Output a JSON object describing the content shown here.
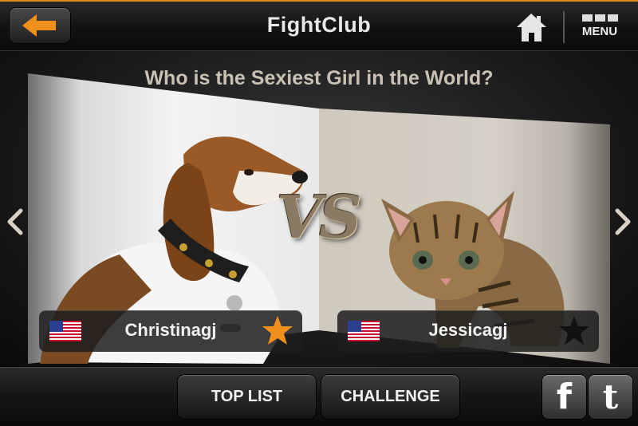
{
  "header": {
    "title": "FightClub",
    "menu_label": "MENU",
    "icons": {
      "back": "back-arrow-icon",
      "home": "home-icon",
      "menu": "menu-grid-icon"
    },
    "accent_color": "#f0901c"
  },
  "main": {
    "question": "Who is the Sexiest Girl in the World?",
    "vs_label": "VS",
    "left": {
      "name": "Christinagj",
      "country": "us-flag-icon",
      "star": "orange",
      "image": "beagle-dog-photo"
    },
    "right": {
      "name": "Jessicagj",
      "country": "us-flag-icon",
      "star": "black",
      "image": "tabby-kitten-photo"
    },
    "colors": {
      "star_selected": "#f0901c",
      "star_unselected": "#111111"
    }
  },
  "footer": {
    "top_list_label": "TOP LIST",
    "challenge_label": "CHALLENGE",
    "facebook_label": "f",
    "twitter_label": "t"
  }
}
